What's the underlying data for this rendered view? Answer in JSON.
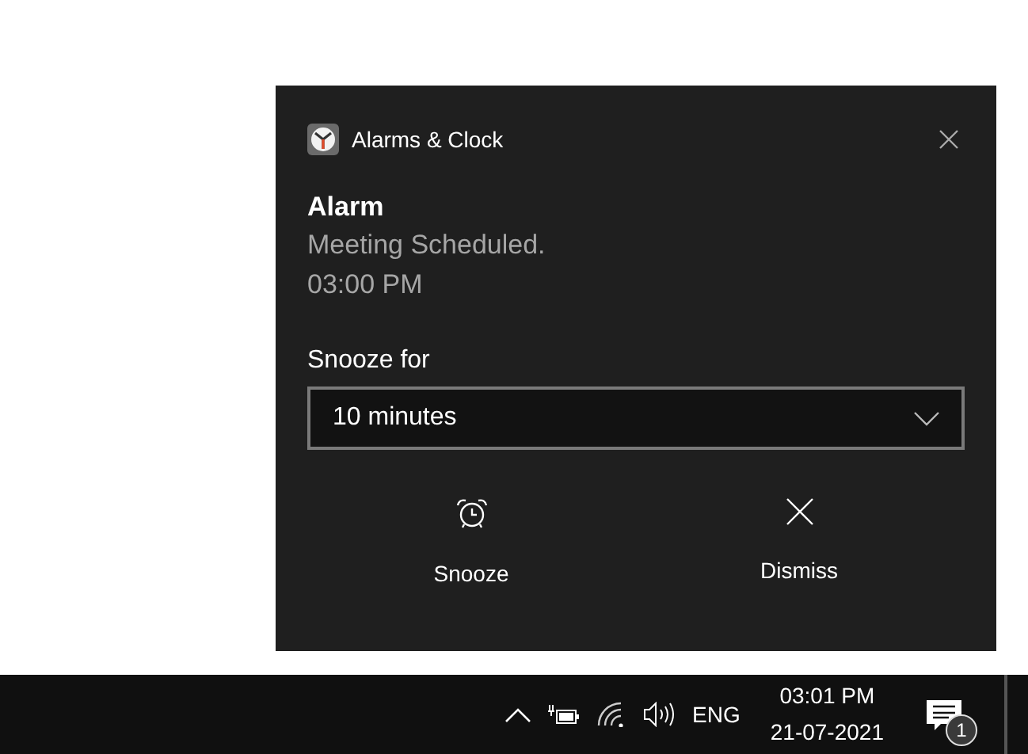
{
  "toast": {
    "app_name": "Alarms & Clock",
    "title": "Alarm",
    "lines": [
      "Meeting Scheduled.",
      "03:00 PM"
    ],
    "snooze_label": "Snooze for",
    "snooze_value": "10 minutes",
    "actions": [
      {
        "kind": "snooze",
        "label": "Snooze"
      },
      {
        "kind": "dismiss",
        "label": "Dismiss"
      }
    ]
  },
  "taskbar": {
    "language": "ENG",
    "time": "03:01 PM",
    "date": "21-07-2021",
    "notification_count": "1"
  }
}
